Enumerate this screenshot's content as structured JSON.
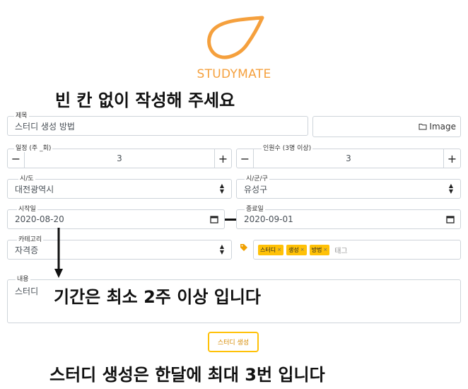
{
  "brand": {
    "name": "STUDYMATE",
    "accent": "#f5a03d"
  },
  "annotations": {
    "top": "빈 칸 없이 작성해 주세요",
    "middle": "기간은 최소 2주 이상 입니다",
    "bottom": "스터디 생성은 한달에 최대 3번 입니다"
  },
  "form": {
    "title": {
      "label": "제목",
      "value": "스터디 생성 방법"
    },
    "image": {
      "label": "Image",
      "icon": "folder-icon"
    },
    "schedule": {
      "label": "일정 (주 _회)",
      "value": "3",
      "minus": "−",
      "plus": "+"
    },
    "members": {
      "label": "인원수 (3명 이상)",
      "value": "3",
      "minus": "−",
      "plus": "+"
    },
    "city": {
      "label": "시/도",
      "value": "대전광역시"
    },
    "district": {
      "label": "시/군/구",
      "value": "유성구"
    },
    "start_date": {
      "label": "시작일",
      "value": "2020-08-20"
    },
    "end_date": {
      "label": "종료일",
      "value": "2020-09-01"
    },
    "category": {
      "label": "카테고리",
      "value": "자격증"
    },
    "tags": {
      "items": [
        "스터디",
        "생성",
        "방법"
      ],
      "remove": "×",
      "placeholder": "태그"
    },
    "content": {
      "label": "내용",
      "value": "스터디"
    },
    "submit": {
      "label": "스터디 생성"
    }
  },
  "colors": {
    "tag": "#ffc107",
    "border": "#ced4da",
    "submit_border": "#ffc107"
  }
}
